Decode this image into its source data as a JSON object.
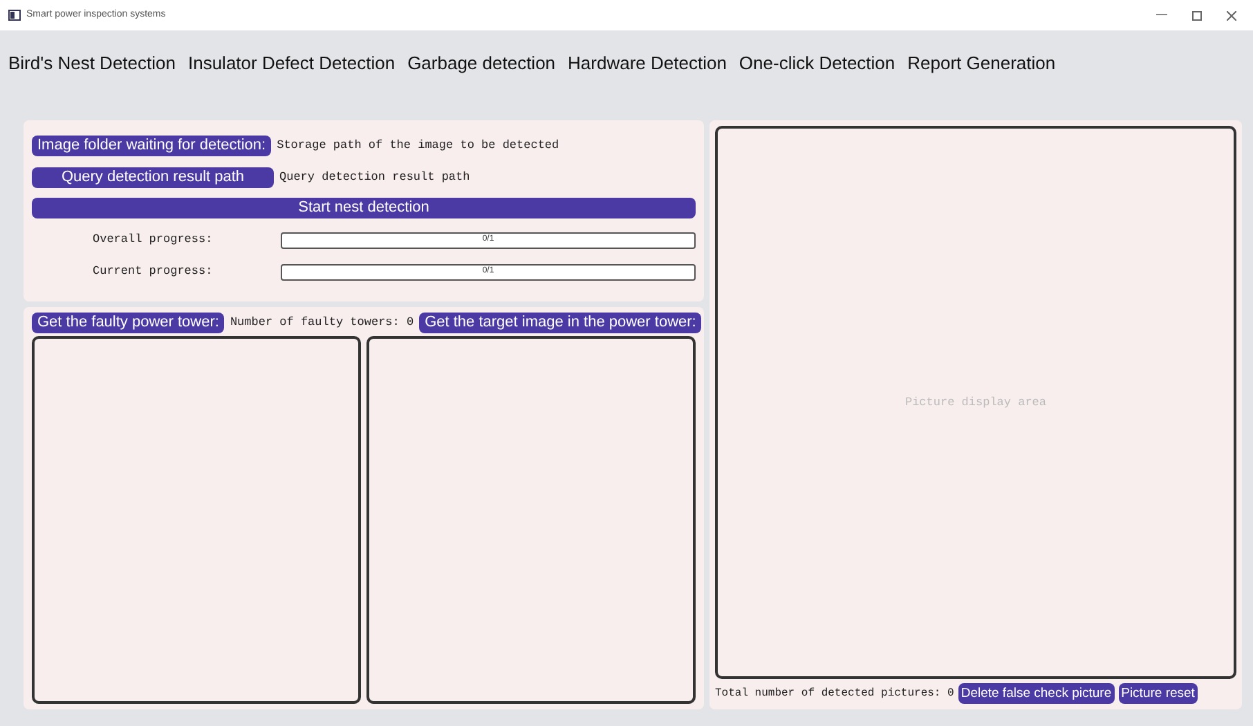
{
  "window": {
    "title": "Smart power inspection systems"
  },
  "menu": [
    {
      "label": "Bird's Nest Detection"
    },
    {
      "label": "Insulator Defect Detection"
    },
    {
      "label": "Garbage detection"
    },
    {
      "label": "Hardware Detection"
    },
    {
      "label": "One-click Detection"
    },
    {
      "label": "Report Generation"
    }
  ],
  "paths": [
    {
      "button": "Image folder waiting for detection:",
      "value": "Storage path of the image to be detected"
    },
    {
      "button": "Query detection result path",
      "value": "Query detection result path"
    }
  ],
  "start_button": "Start nest detection",
  "progress": [
    {
      "label": "Overall progress:",
      "level": 0,
      "reading": "0/1"
    },
    {
      "label": "Current progress:",
      "level": 0,
      "reading": "0/1"
    }
  ],
  "towers": {
    "faulty_button": "Get the faulty power tower:",
    "count_text": "Number of faulty towers: 0",
    "target_button": "Get the target image in the power tower:"
  },
  "display": {
    "placeholder": "Picture display area",
    "total_text": "Total number of detected pictures: 0",
    "delete_button": "Delete false check picture",
    "reset_button": "Picture reset"
  }
}
